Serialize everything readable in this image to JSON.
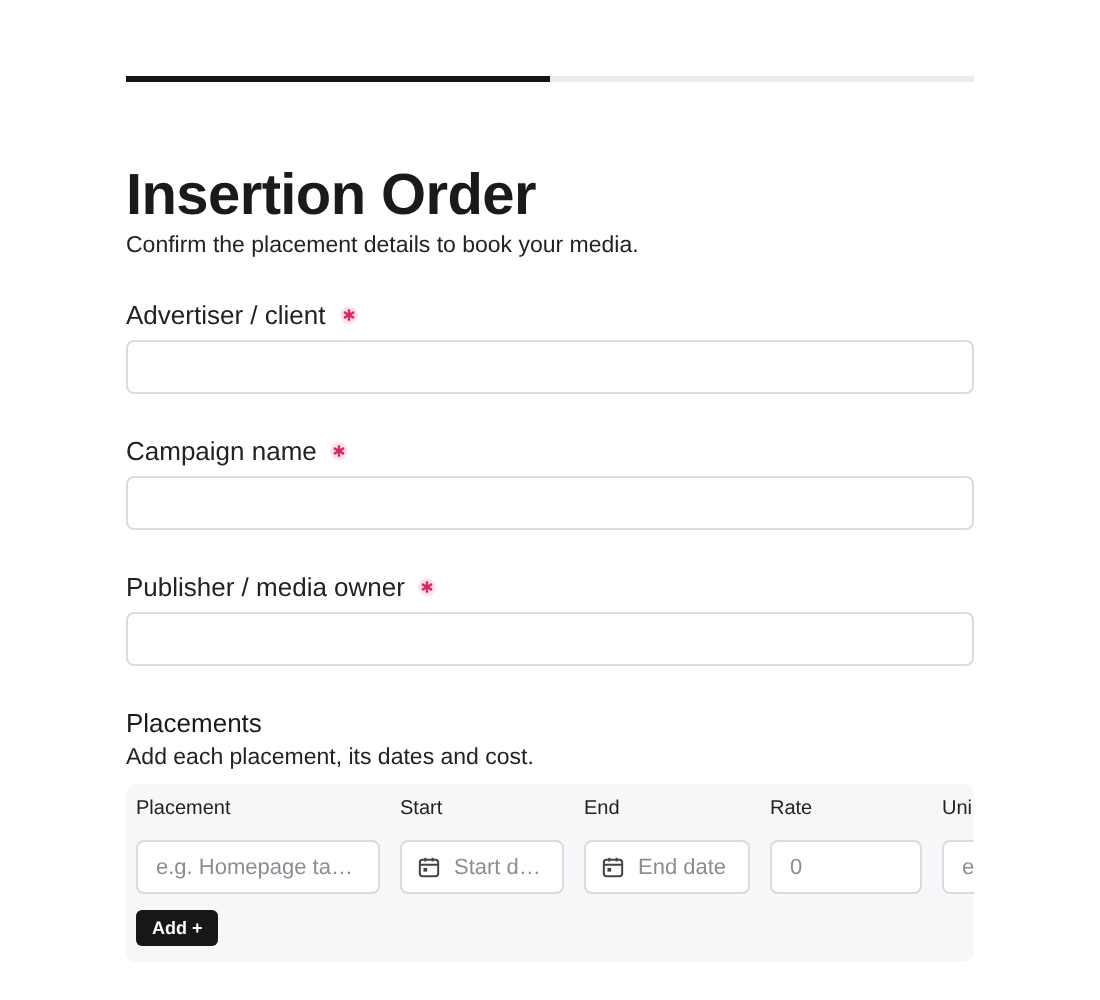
{
  "progress": {
    "level": 0.5
  },
  "title": "Insertion Order",
  "subtitle": "Confirm the placement details to book your media.",
  "fields": [
    {
      "label": "Advertiser / client",
      "required": true
    },
    {
      "label": "Campaign name",
      "required": true
    },
    {
      "label": "Publisher / media owner",
      "required": true
    }
  ],
  "placements": {
    "heading": "Placements",
    "description": "Add each placement, its dates and cost.",
    "columns": [
      {
        "label": "Placement",
        "kind": "text",
        "placeholder": "e.g. Homepage ta…"
      },
      {
        "label": "Start",
        "kind": "date",
        "placeholder": "Start d…"
      },
      {
        "label": "End",
        "kind": "date",
        "placeholder": "End date"
      },
      {
        "label": "Rate",
        "kind": "text",
        "placeholder": "0"
      },
      {
        "label": "Uni",
        "kind": "text",
        "placeholder": "e"
      }
    ],
    "add_button": "Add +"
  }
}
